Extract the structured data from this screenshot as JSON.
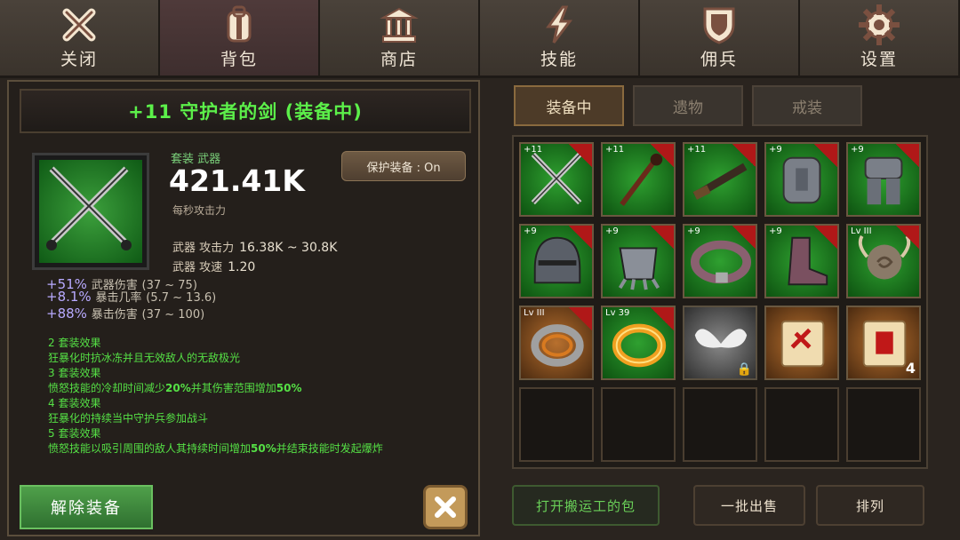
{
  "nav": {
    "tabs": [
      {
        "label": "关闭",
        "icon": "close-icon"
      },
      {
        "label": "背包",
        "icon": "backpack-icon"
      },
      {
        "label": "商店",
        "icon": "shop-icon"
      },
      {
        "label": "技能",
        "icon": "lightning-icon"
      },
      {
        "label": "佣兵",
        "icon": "shield-icon"
      },
      {
        "label": "设置",
        "icon": "gear-icon"
      }
    ],
    "active": "背包"
  },
  "item": {
    "title": "+11 守护者的剑 (装备中)",
    "set_label": "套装 武器",
    "attack_value": "421.41K",
    "attack_caption": "每秒攻击力",
    "protect_button": "保护装备 : On",
    "stats": [
      {
        "key": "武器 攻击力",
        "value": "16.38K ~ 30.8K"
      },
      {
        "key": "武器 攻速",
        "value": "1.20"
      }
    ],
    "bonuses": [
      {
        "value": "+51%",
        "name": "武器伤害",
        "range": "(37 ~ 75)"
      },
      {
        "value": "+8.1%",
        "name": "暴击几率",
        "range": "(5.7 ~ 13.6)"
      },
      {
        "value": "+88%",
        "name": "暴击伤害",
        "range": "(37 ~ 100)"
      }
    ],
    "set_effects": {
      "h2": "2 套装效果",
      "t2": "狂暴化时抗冰冻并且无效敌人的无敌极光",
      "h3": "3 套装效果",
      "t3a": "愤怒技能的冷却时间减少",
      "t3b": "20%",
      "t3c": "并其伤害范围增加",
      "t3d": "50%",
      "h4": "4 套装效果",
      "t4": "狂暴化的持续当中守护兵参加战斗",
      "h5": "5 套装效果",
      "t5a": "愤怒技能以吸引周围的敌人其持续时间增加",
      "t5b": "50%",
      "t5c": "并结束技能时发起爆炸"
    },
    "unequip_button": "解除装备"
  },
  "subtabs": [
    "装备中",
    "遗物",
    "戒装"
  ],
  "inventory": [
    {
      "style": "green",
      "level": "+11",
      "art": "crossed-swords",
      "ribbon": true
    },
    {
      "style": "green",
      "level": "+11",
      "art": "staff",
      "ribbon": true
    },
    {
      "style": "green",
      "level": "+11",
      "art": "rifle",
      "ribbon": true
    },
    {
      "style": "green",
      "level": "+9",
      "art": "chest-armor",
      "ribbon": true
    },
    {
      "style": "green",
      "level": "+9",
      "art": "leg-armor",
      "ribbon": true
    },
    {
      "style": "green",
      "level": "+9",
      "art": "helmet",
      "ribbon": true
    },
    {
      "style": "green",
      "level": "+9",
      "art": "gauntlet",
      "ribbon": true
    },
    {
      "style": "green",
      "level": "+9",
      "art": "belt",
      "ribbon": true
    },
    {
      "style": "green",
      "level": "+9",
      "art": "boot",
      "ribbon": true
    },
    {
      "style": "green",
      "level": "Lv III",
      "art": "horn-relic",
      "ribbon": true
    },
    {
      "style": "brown",
      "level": "Lv III",
      "art": "ring-silver",
      "ribbon": true
    },
    {
      "style": "green",
      "level": "Lv 39",
      "art": "ring-gold",
      "ribbon": true
    },
    {
      "style": "gray",
      "level": "",
      "art": "wings",
      "ribbon": false,
      "locked": true
    },
    {
      "style": "brown",
      "level": "",
      "art": "scroll-red",
      "ribbon": false
    },
    {
      "style": "brown",
      "level": "",
      "art": "scroll-red2",
      "ribbon": false,
      "count": "4"
    },
    {
      "style": "empty"
    },
    {
      "style": "empty"
    },
    {
      "style": "empty"
    },
    {
      "style": "empty"
    },
    {
      "style": "empty"
    }
  ],
  "bottom_buttons": {
    "open_porter": "打开搬运工的包",
    "sell_batch": "一批出售",
    "sort": "排列"
  }
}
